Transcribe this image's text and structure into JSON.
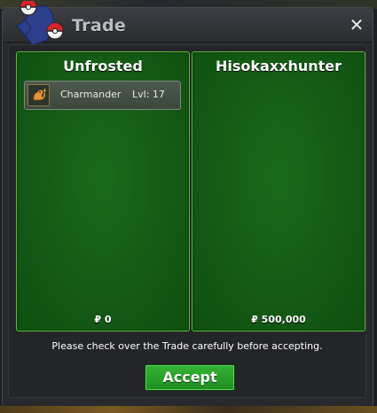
{
  "window": {
    "title": "Trade",
    "close_icon": "close-icon"
  },
  "colors": {
    "panel_green": "#155d16",
    "panel_border": "#5fbf3c",
    "accept_green": "#2aa52a"
  },
  "left_panel": {
    "player": "Unfrosted",
    "items": [
      {
        "icon": "charmander-icon",
        "name": "Charmander",
        "level": "Lvl: 17"
      }
    ],
    "money": "₽ 0"
  },
  "right_panel": {
    "player": "Hisokaxxhunter",
    "items": [],
    "money": "₽ 500,000"
  },
  "notice": "Please check over the Trade carefully before accepting.",
  "accept_label": "Accept"
}
